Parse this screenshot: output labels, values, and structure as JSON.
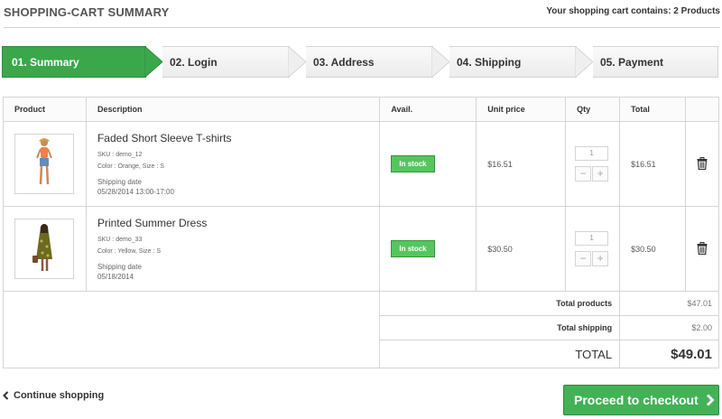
{
  "header": {
    "title": "Shopping-cart summary",
    "cart_count": "Your shopping cart contains: 2 Products"
  },
  "steps": [
    {
      "label": "01. Summary",
      "active": true
    },
    {
      "label": "02. Login",
      "active": false
    },
    {
      "label": "03. Address",
      "active": false
    },
    {
      "label": "04. Shipping",
      "active": false
    },
    {
      "label": "05. Payment",
      "active": false
    }
  ],
  "table": {
    "headers": {
      "product": "Product",
      "description": "Description",
      "avail": "Avail.",
      "unit_price": "Unit price",
      "qty": "Qty",
      "total": "Total"
    },
    "items": [
      {
        "name": "Faded Short Sleeve T-shirts",
        "sku": "SKU : demo_12",
        "attributes": "Color : Orange, Size : S",
        "shipping_label": "Shipping date",
        "shipping_date": "05/28/2014 13:00-17:00",
        "availability": "In stock",
        "unit_price": "$16.51",
        "qty": "1",
        "total": "$16.51"
      },
      {
        "name": "Printed Summer Dress",
        "sku": "SKU : demo_33",
        "attributes": "Color : Yellow, Size : S",
        "shipping_label": "Shipping date",
        "shipping_date": "05/18/2014",
        "availability": "In stock",
        "unit_price": "$30.50",
        "qty": "1",
        "total": "$30.50"
      }
    ],
    "qty_minus": "−",
    "qty_plus": "+"
  },
  "summary": {
    "total_products_label": "Total products",
    "total_products": "$47.01",
    "total_shipping_label": "Total shipping",
    "total_shipping": "$2.00",
    "total_label": "TOTAL",
    "total": "$49.01"
  },
  "actions": {
    "continue_shopping": "Continue shopping",
    "proceed_checkout": "Proceed to checkout"
  },
  "colors": {
    "accent_green": "#3aa74b",
    "stock_green": "#55c65e"
  },
  "icons": [
    "trash-icon",
    "chevron-left-icon",
    "chevron-right-icon"
  ]
}
